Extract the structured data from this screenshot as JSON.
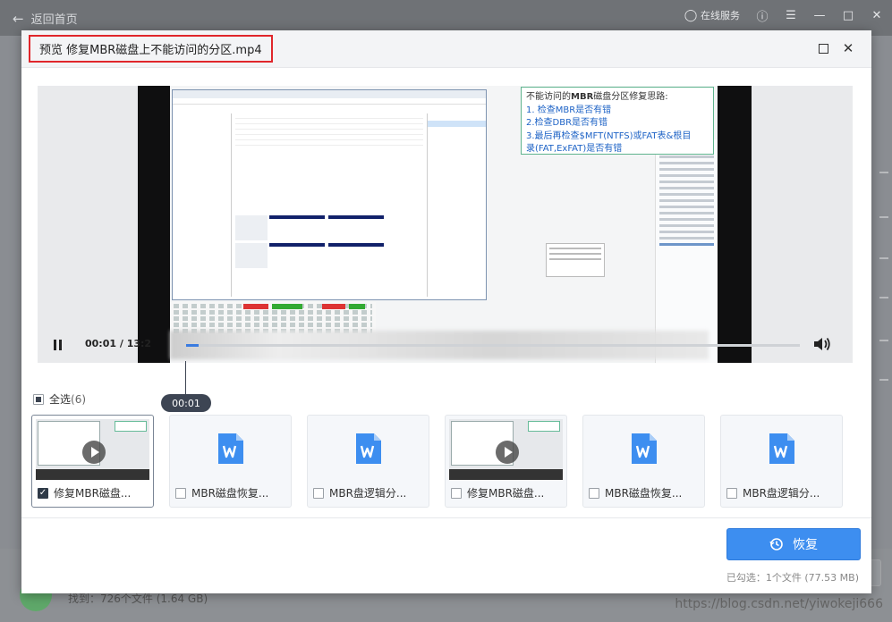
{
  "background": {
    "back_label": "返回首页",
    "service_label": "在线服务",
    "found_label": "找到：726个文件 (1.64 GB)",
    "watermark": "https://blog.csdn.net/yiwokeji666"
  },
  "modal": {
    "title": "预览 修复MBR磁盘上不能访问的分区.mp4"
  },
  "video": {
    "note": {
      "line1_pre": "不能访问的",
      "line1_bold": "MBR",
      "line1_post": "磁盘分区修复思路:",
      "line2": "1. 检查MBR是否有错",
      "line3": "2.检查DBR是否有错",
      "line4": "3.最后再检查$MFT(NTFS)或FAT表&根目",
      "line5": "录(FAT,ExFAT)是否有错"
    },
    "time": "00:01 / 13:2",
    "progress": 0.02,
    "tooltip": "00:01"
  },
  "select_all": {
    "label": "全选",
    "count": "(6)"
  },
  "files": [
    {
      "name": "修复MBR磁盘...",
      "type": "video",
      "checked": true
    },
    {
      "name": "MBR磁盘恢复...",
      "type": "doc",
      "checked": false
    },
    {
      "name": "MBR盘逻辑分...",
      "type": "doc",
      "checked": false
    },
    {
      "name": "修复MBR磁盘...",
      "type": "video",
      "checked": false
    },
    {
      "name": "MBR磁盘恢复...",
      "type": "doc",
      "checked": false
    },
    {
      "name": "MBR盘逻辑分...",
      "type": "doc",
      "checked": false
    }
  ],
  "footer": {
    "recover_label": "恢复",
    "selected_info": "已勾选：1个文件 (77.53 MB)"
  },
  "colors": {
    "accent": "#3d8ef0",
    "title_highlight": "#e0262b"
  }
}
